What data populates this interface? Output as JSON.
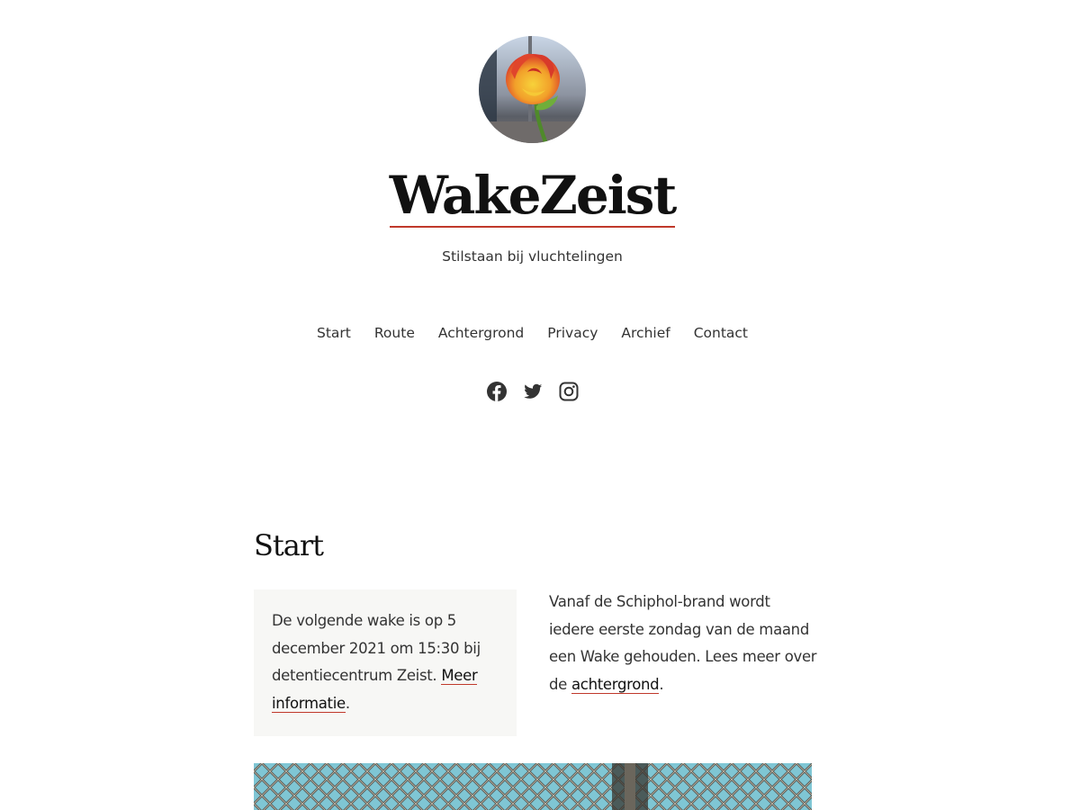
{
  "site": {
    "title": "WakeZeist",
    "tagline": "Stilstaan bij vluchtelingen"
  },
  "nav": {
    "items": [
      {
        "label": "Start"
      },
      {
        "label": "Route"
      },
      {
        "label": "Achtergrond"
      },
      {
        "label": "Privacy"
      },
      {
        "label": "Archief"
      },
      {
        "label": "Contact"
      }
    ]
  },
  "social": {
    "icons": [
      "facebook-icon",
      "twitter-icon",
      "instagram-icon"
    ]
  },
  "main": {
    "heading": "Start",
    "notice": {
      "text": "De volgende wake is op 5 december 2021 om 15:30 bij detentiecentrum Zeist. ",
      "link": "Meer informatie",
      "suffix": "."
    },
    "intro": {
      "text": "Vanaf de Schiphol-brand wordt iedere eerste zondag van de maand een Wake gehouden. Lees meer over de ",
      "link": "achtergrond",
      "suffix": "."
    }
  },
  "colors": {
    "accent": "#c0392b",
    "box_background": "#f7f7f5",
    "text": "#333333",
    "heading": "#111111"
  }
}
